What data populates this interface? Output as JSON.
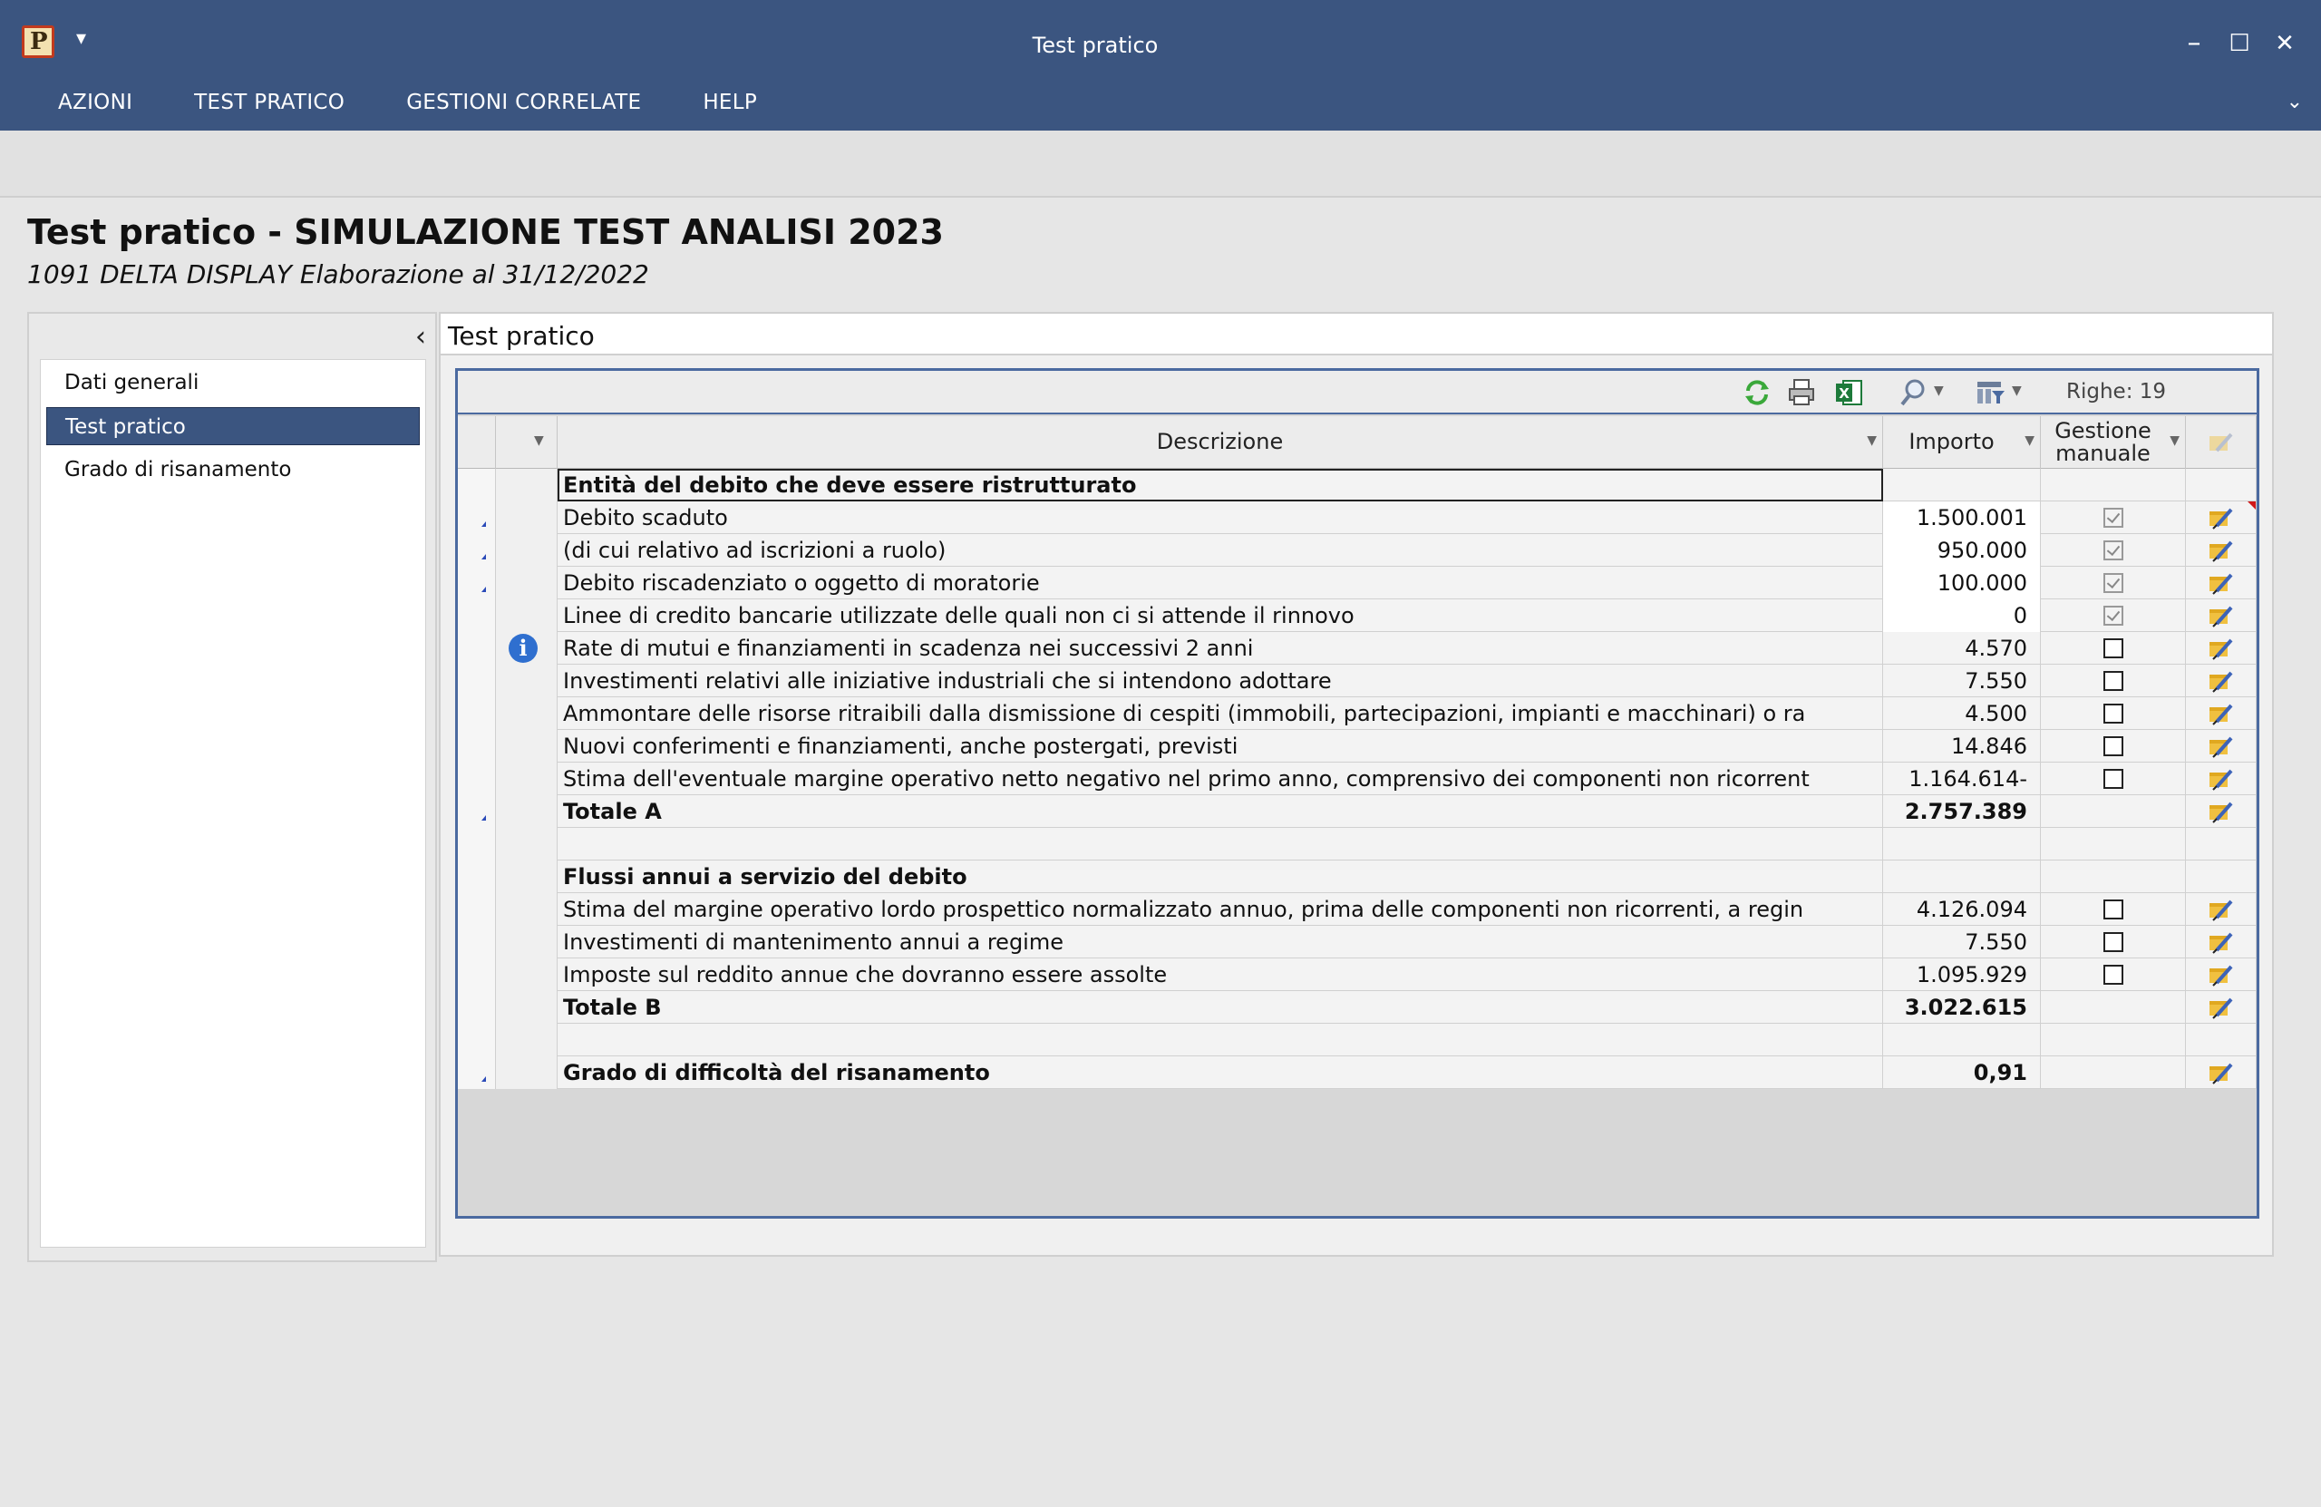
{
  "window": {
    "title": "Test pratico",
    "app_icon_letter": "P",
    "qat_glyph": "▾",
    "minimize": "–",
    "maximize": "☐",
    "close": "✕",
    "ribbon_toggle": "⌄"
  },
  "menu": [
    "AZIONI",
    "TEST PRATICO",
    "GESTIONI CORRELATE",
    "HELP"
  ],
  "page": {
    "title": "Test pratico - SIMULAZIONE TEST ANALISI 2023",
    "subtitle": "1091 DELTA DISPLAY Elaborazione al 31/12/2022"
  },
  "nav": {
    "collapse_glyph": "‹",
    "items": [
      {
        "label": "Dati generali",
        "active": false
      },
      {
        "label": "Test pratico",
        "active": true
      },
      {
        "label": "Grado di risanamento",
        "active": false
      }
    ]
  },
  "content": {
    "title": "Test pratico",
    "toolbar": {
      "righe_label": "Righe: 19"
    },
    "columns": {
      "descrizione": "Descrizione",
      "importo": "Importo",
      "gestione_line1": "Gestione",
      "gestione_line2": "manuale"
    },
    "rows": [
      {
        "desc": "Entità del debito che deve essere ristrutturato",
        "importo": "",
        "checkbox": "none",
        "edit": false,
        "bold": true,
        "marker": false,
        "info": false,
        "input": false
      },
      {
        "desc": "Debito scaduto",
        "importo": "1.500.001",
        "checkbox": "checked",
        "edit": true,
        "bold": false,
        "marker": true,
        "info": false,
        "input": true
      },
      {
        "desc": "(di cui relativo ad iscrizioni a ruolo)",
        "importo": "950.000",
        "checkbox": "checked",
        "edit": true,
        "bold": false,
        "marker": true,
        "info": false,
        "input": true
      },
      {
        "desc": "Debito riscadenziato o oggetto di moratorie",
        "importo": "100.000",
        "checkbox": "checked",
        "edit": true,
        "bold": false,
        "marker": true,
        "info": false,
        "input": true
      },
      {
        "desc": "Linee di credito bancarie utilizzate delle quali non ci si attende il rinnovo",
        "importo": "0",
        "checkbox": "checked",
        "edit": true,
        "bold": false,
        "marker": false,
        "info": false,
        "input": true
      },
      {
        "desc": "Rate di mutui e finanziamenti in scadenza nei successivi 2 anni",
        "importo": "4.570",
        "checkbox": "unchecked",
        "edit": true,
        "bold": false,
        "marker": false,
        "info": true,
        "input": false
      },
      {
        "desc": "Investimenti relativi alle iniziative industriali che si intendono adottare",
        "importo": "7.550",
        "checkbox": "unchecked",
        "edit": true,
        "bold": false,
        "marker": false,
        "info": false,
        "input": false
      },
      {
        "desc": "Ammontare delle risorse ritraibili dalla dismissione di cespiti (immobili, partecipazioni, impianti e macchinari) o ra",
        "importo": "4.500",
        "checkbox": "unchecked",
        "edit": true,
        "bold": false,
        "marker": false,
        "info": false,
        "input": false
      },
      {
        "desc": "Nuovi conferimenti e finanziamenti, anche postergati, previsti",
        "importo": "14.846",
        "checkbox": "unchecked",
        "edit": true,
        "bold": false,
        "marker": false,
        "info": false,
        "input": false
      },
      {
        "desc": "Stima dell'eventuale margine operativo netto negativo nel primo anno, comprensivo dei componenti non ricorrent",
        "importo": "1.164.614-",
        "checkbox": "unchecked",
        "edit": true,
        "bold": false,
        "marker": false,
        "info": false,
        "input": false
      },
      {
        "desc": "Totale A",
        "importo": "2.757.389",
        "checkbox": "none",
        "edit": true,
        "bold": true,
        "marker": true,
        "info": false,
        "input": false
      },
      {
        "desc": "",
        "importo": "",
        "checkbox": "none",
        "edit": false,
        "bold": false,
        "marker": false,
        "info": false,
        "input": false
      },
      {
        "desc": "Flussi annui a servizio del debito",
        "importo": "",
        "checkbox": "none",
        "edit": false,
        "bold": true,
        "marker": false,
        "info": false,
        "input": false
      },
      {
        "desc": "Stima del margine operativo lordo prospettico normalizzato annuo, prima delle componenti non ricorrenti, a regin",
        "importo": "4.126.094",
        "checkbox": "unchecked",
        "edit": true,
        "bold": false,
        "marker": false,
        "info": false,
        "input": false
      },
      {
        "desc": "Investimenti di mantenimento annui a regime",
        "importo": "7.550",
        "checkbox": "unchecked",
        "edit": true,
        "bold": false,
        "marker": false,
        "info": false,
        "input": false
      },
      {
        "desc": "Imposte sul reddito annue che dovranno essere assolte",
        "importo": "1.095.929",
        "checkbox": "unchecked",
        "edit": true,
        "bold": false,
        "marker": false,
        "info": false,
        "input": false
      },
      {
        "desc": "Totale B",
        "importo": "3.022.615",
        "checkbox": "none",
        "edit": true,
        "bold": true,
        "marker": false,
        "info": false,
        "input": false
      },
      {
        "desc": "",
        "importo": "",
        "checkbox": "none",
        "edit": false,
        "bold": false,
        "marker": false,
        "info": false,
        "input": false
      },
      {
        "desc": "Grado di difficoltà del risanamento",
        "importo": "0,91",
        "checkbox": "none",
        "edit": true,
        "bold": true,
        "marker": true,
        "info": false,
        "input": false
      }
    ]
  }
}
